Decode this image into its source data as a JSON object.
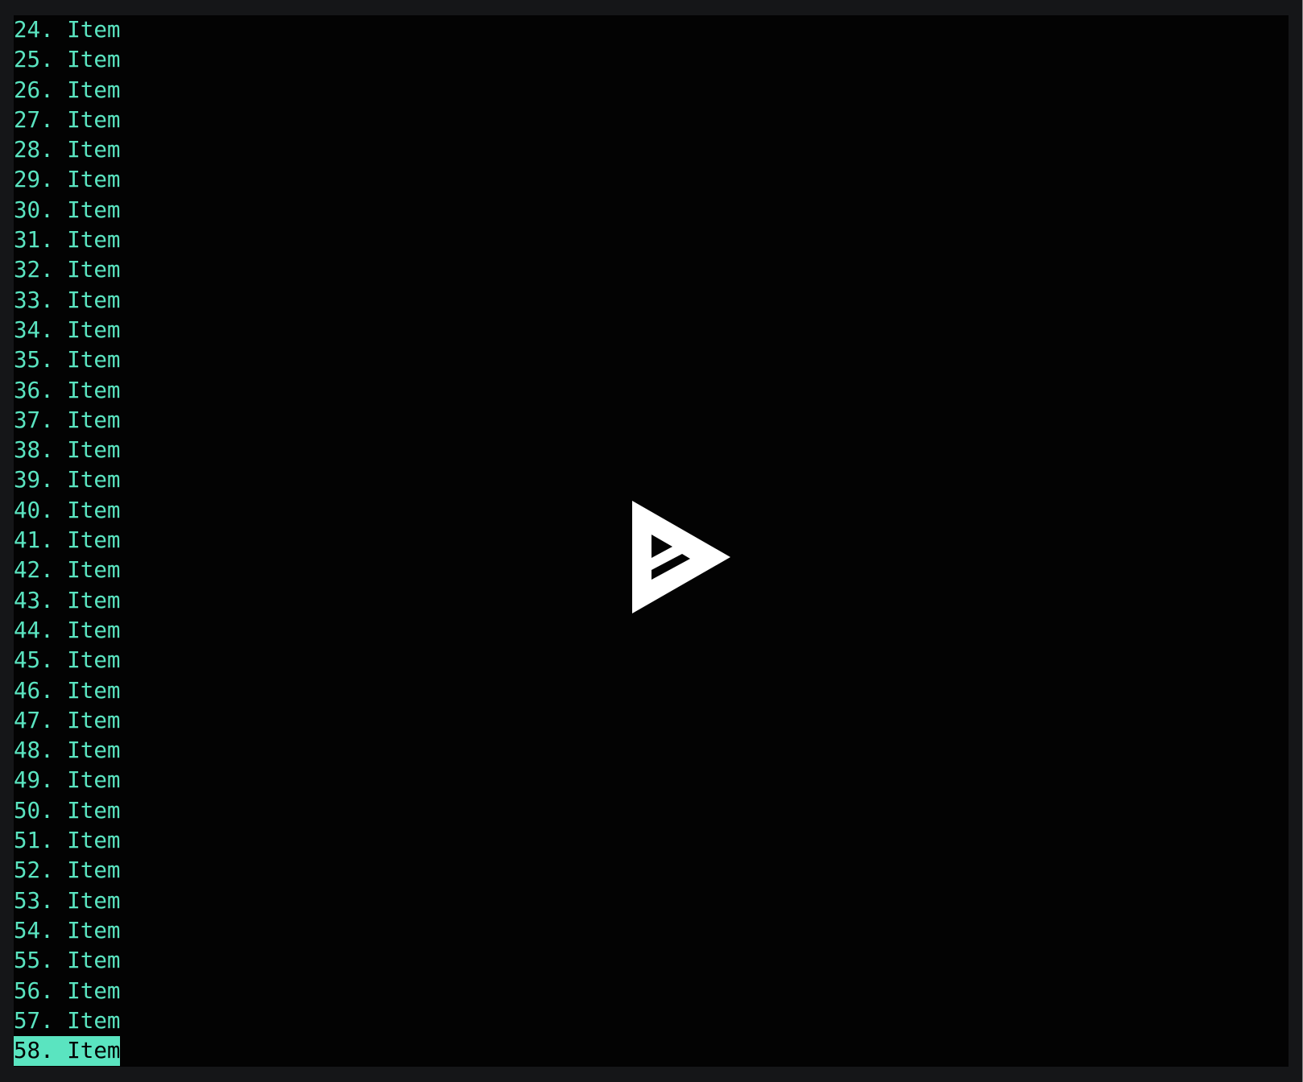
{
  "terminal": {
    "list_items": [
      {
        "number": "24.",
        "label": "Item",
        "selected": false
      },
      {
        "number": "25.",
        "label": "Item",
        "selected": false
      },
      {
        "number": "26.",
        "label": "Item",
        "selected": false
      },
      {
        "number": "27.",
        "label": "Item",
        "selected": false
      },
      {
        "number": "28.",
        "label": "Item",
        "selected": false
      },
      {
        "number": "29.",
        "label": "Item",
        "selected": false
      },
      {
        "number": "30.",
        "label": "Item",
        "selected": false
      },
      {
        "number": "31.",
        "label": "Item",
        "selected": false
      },
      {
        "number": "32.",
        "label": "Item",
        "selected": false
      },
      {
        "number": "33.",
        "label": "Item",
        "selected": false
      },
      {
        "number": "34.",
        "label": "Item",
        "selected": false
      },
      {
        "number": "35.",
        "label": "Item",
        "selected": false
      },
      {
        "number": "36.",
        "label": "Item",
        "selected": false
      },
      {
        "number": "37.",
        "label": "Item",
        "selected": false
      },
      {
        "number": "38.",
        "label": "Item",
        "selected": false
      },
      {
        "number": "39.",
        "label": "Item",
        "selected": false
      },
      {
        "number": "40.",
        "label": "Item",
        "selected": false
      },
      {
        "number": "41.",
        "label": "Item",
        "selected": false
      },
      {
        "number": "42.",
        "label": "Item",
        "selected": false
      },
      {
        "number": "43.",
        "label": "Item",
        "selected": false
      },
      {
        "number": "44.",
        "label": "Item",
        "selected": false
      },
      {
        "number": "45.",
        "label": "Item",
        "selected": false
      },
      {
        "number": "46.",
        "label": "Item",
        "selected": false
      },
      {
        "number": "47.",
        "label": "Item",
        "selected": false
      },
      {
        "number": "48.",
        "label": "Item",
        "selected": false
      },
      {
        "number": "49.",
        "label": "Item",
        "selected": false
      },
      {
        "number": "50.",
        "label": "Item",
        "selected": false
      },
      {
        "number": "51.",
        "label": "Item",
        "selected": false
      },
      {
        "number": "52.",
        "label": "Item",
        "selected": false
      },
      {
        "number": "53.",
        "label": "Item",
        "selected": false
      },
      {
        "number": "54.",
        "label": "Item",
        "selected": false
      },
      {
        "number": "55.",
        "label": "Item",
        "selected": false
      },
      {
        "number": "56.",
        "label": "Item",
        "selected": false
      },
      {
        "number": "57.",
        "label": "Item",
        "selected": false
      },
      {
        "number": "58.",
        "label": "Item",
        "selected": true
      }
    ],
    "logo_icon": "asciinema-play-logo",
    "colors": {
      "text": "#5ae4c0",
      "selection_bg": "#5ae4c0",
      "selection_text": "#030303",
      "terminal_bg": "#030303",
      "frame_bg": "#151618"
    }
  }
}
